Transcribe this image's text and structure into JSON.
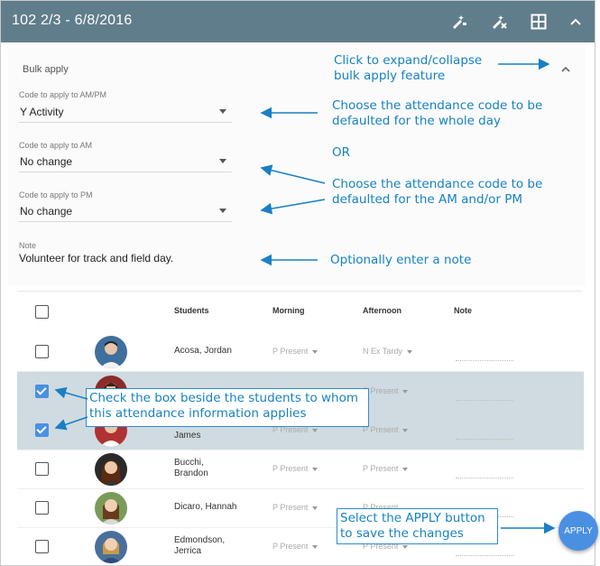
{
  "header": {
    "title": "102 2/3 - 6/8/2016",
    "icons": [
      "wand-icon",
      "wand-off-icon",
      "grid-icon",
      "chevron-up-icon"
    ]
  },
  "bulk": {
    "label": "Bulk apply",
    "ampm": {
      "label": "Code to apply to AM/PM",
      "value": "Y Activity"
    },
    "am": {
      "label": "Code to apply to AM",
      "value": "No change"
    },
    "pm": {
      "label": "Code to apply to PM",
      "value": "No change"
    },
    "note": {
      "label": "Note",
      "value": "Volunteer for track and field day."
    }
  },
  "annotations": {
    "expand": "Click to expand/collapse\nbulk apply feature",
    "whole_day": "Choose the attendance code to be\ndefaulted for the whole day",
    "or": "OR",
    "ampm": "Choose the attendance code to be\ndefaulted for the AM and/or PM",
    "note": "Optionally enter a note",
    "checkbox": "Check the box beside the students to whom\nthis attendance information applies",
    "apply": "Select the APPLY button\nto save the changes"
  },
  "table": {
    "headers": {
      "students": "Students",
      "morning": "Morning",
      "afternoon": "Afternoon",
      "note": "Note"
    },
    "rows": [
      {
        "name": "Acosa, Jordan",
        "morning": "P Present",
        "afternoon": "N Ex Tardy",
        "checked": false
      },
      {
        "name": "",
        "morning": "",
        "afternoon": "P Present",
        "checked": true
      },
      {
        "name": "James",
        "morning": "P Present",
        "afternoon": "P Present",
        "checked": true
      },
      {
        "name": "Bucchi,\nBrandon",
        "morning": "P Present",
        "afternoon": "P Present",
        "checked": false
      },
      {
        "name": "Dicaro, Hannah",
        "morning": "P Present",
        "afternoon": "P Present",
        "checked": false
      },
      {
        "name": "Edmondson,\nJerrica",
        "morning": "P Present",
        "afternoon": "P Present",
        "checked": false
      }
    ]
  },
  "apply_button": {
    "label": "APPLY"
  },
  "colors": {
    "header": "#607d8b",
    "accent": "#4a90e2",
    "annotation": "#1682c0",
    "selected_row": "#cfdbe0"
  }
}
